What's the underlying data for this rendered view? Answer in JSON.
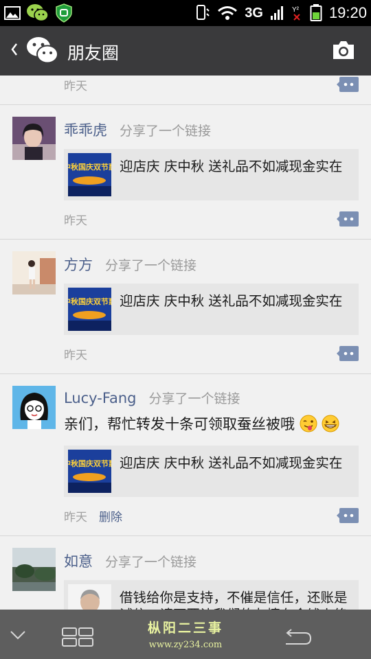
{
  "status_bar": {
    "network": "3G",
    "time": "19:20"
  },
  "header": {
    "title": "朋友圈"
  },
  "feed": {
    "top_partial": {
      "time": "昨天"
    },
    "posts": [
      {
        "name": "乖乖虎",
        "action": "分享了一个链接",
        "link_title": "迎店庆 庆中秋 送礼品不如减现金实在",
        "time": "昨天"
      },
      {
        "name": "方方",
        "action": "分享了一个链接",
        "link_title": "迎店庆 庆中秋 送礼品不如减现金实在",
        "time": "昨天"
      },
      {
        "name": "Lucy-Fang",
        "action": "分享了一个链接",
        "text": "亲们，帮忙转发十条可领取蚕丝被哦",
        "link_title": "迎店庆 庆中秋 送礼品不如减现金实在",
        "time": "昨天",
        "delete_label": "删除"
      },
      {
        "name": "如意",
        "action": "分享了一个链接",
        "link_title": "借钱给你是支持，不催是信任，还账是诚信，请不要让我们的友情在金钱上终结"
      }
    ],
    "thumb_banner_text": "中秋国庆双节惠"
  },
  "nav": {
    "watermark": "枞阳二三事",
    "watermark_url": "www.zy234.com"
  },
  "colors": {
    "action_bar": "#3a3a3c",
    "name_link": "#4b5f8a",
    "background": "#f1f1f1",
    "nav_bar": "#5e5e5e"
  }
}
